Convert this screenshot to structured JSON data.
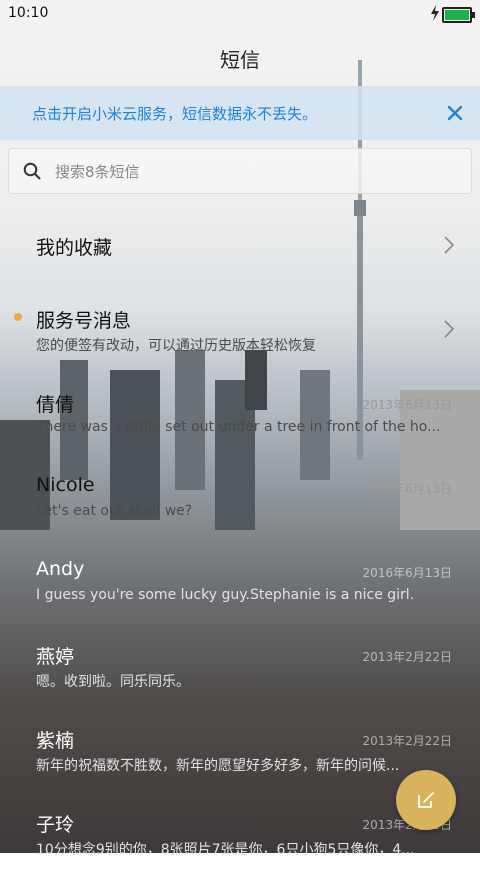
{
  "status": {
    "time": "10:10"
  },
  "header": {
    "title": "短信"
  },
  "banner": {
    "text": "点击开启小米云服务，短信数据永不丢失。"
  },
  "search": {
    "placeholder": "搜索8条短信"
  },
  "favorites": {
    "label": "我的收藏"
  },
  "service": {
    "label": "服务号消息",
    "preview": "您的便签有改动，可以通过历史版本轻松恢复"
  },
  "conversations": [
    {
      "name": "倩倩",
      "preview": "There was a table set out under a tree in front of the ho...",
      "date": "2013年6月13日"
    },
    {
      "name": "Nicole",
      "preview": "Let's eat out,shall we?",
      "date": "2016年6月13日"
    },
    {
      "name": "Andy",
      "preview": "I guess you're some lucky guy.Stephanie is a nice girl.",
      "date": "2016年6月13日"
    },
    {
      "name": "燕婷",
      "preview": "嗯。收到啦。同乐同乐。",
      "date": "2013年2月22日"
    },
    {
      "name": "紫楠",
      "preview": "新年的祝福数不胜数，新年的愿望好多好多，新年的问候...",
      "date": "2013年2月22日"
    },
    {
      "name": "子玲",
      "preview": "10分想念9别的你，8张照片7张是你，6只小狗5只像你，4...",
      "date": "2013年2月22日"
    }
  ],
  "colors": {
    "accent": "#1d82d4",
    "badge": "#f2a93b",
    "fab": "#d9b25c"
  },
  "icons": {
    "banner_close": "close-icon",
    "search": "search-icon",
    "fab": "compose-icon"
  }
}
